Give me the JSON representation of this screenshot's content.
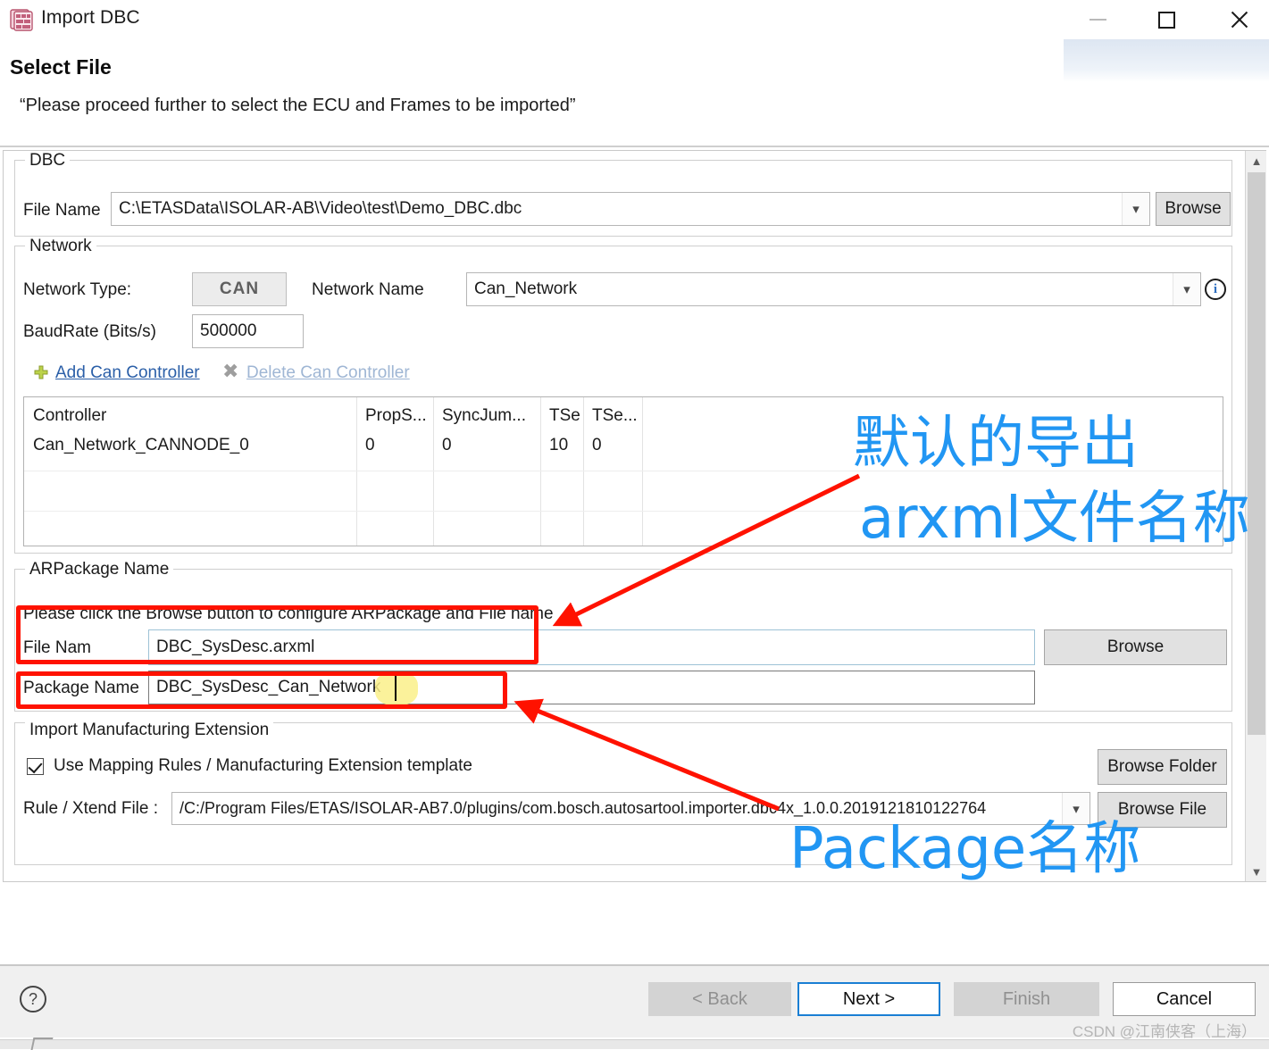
{
  "window": {
    "title": "Import DBC",
    "app_icon": "dbc-grid-icon",
    "minimize": "minimize-icon",
    "maximize": "maximize-icon",
    "close": "close-icon"
  },
  "header": {
    "title": "Select File",
    "subtitle": "“Please proceed further to select the ECU and Frames to be imported”"
  },
  "dbc_group": {
    "legend": "DBC",
    "file_name_label": "File Name",
    "file_name_value": "C:\\ETASData\\ISOLAR-AB\\Video\\test\\Demo_DBC.dbc",
    "browse_label": "Browse"
  },
  "network_group": {
    "legend": "Network",
    "network_type_label": "Network Type:",
    "network_type_value": "CAN",
    "network_name_label": "Network Name",
    "network_name_value": "Can_Network",
    "baudrate_label": "BaudRate (Bits/s)",
    "baudrate_value": "500000",
    "info_icon": "info-icon",
    "add_controller_label": "Add Can Controller",
    "delete_controller_label": "Delete Can Controller",
    "table": {
      "columns": [
        "Controller",
        "PropS...",
        "SyncJum...",
        "TSe...",
        "TSe...",
        ""
      ],
      "rows": [
        [
          "Can_Network_CANNODE_0",
          "0",
          "0",
          "10",
          "0",
          ""
        ]
      ]
    }
  },
  "arpackage_group": {
    "legend": "ARPackage Name",
    "hint": "Please click the Browse button to configure ARPackage and File name",
    "file_name_label": "File Nam",
    "file_name_value": "DBC_SysDesc.arxml",
    "package_name_label": "Package Name",
    "package_name_value": "DBC_SysDesc_Can_Network",
    "browse_label": "Browse"
  },
  "manufacturing_group": {
    "legend": "Import Manufacturing Extension",
    "checkbox_label": "Use Mapping Rules / Manufacturing Extension template",
    "checkbox_checked": true,
    "rule_file_label": "Rule / Xtend File :",
    "rule_file_value": "/C:/Program Files/ETAS/ISOLAR-AB7.0/plugins/com.bosch.autosartool.importer.dbc4x_1.0.0.2019121810122764",
    "browse_folder_label": "Browse Folder",
    "browse_file_label": "Browse File"
  },
  "footer": {
    "help_icon": "help-icon",
    "back_label": "< Back",
    "next_label": "Next >",
    "finish_label": "Finish",
    "cancel_label": "Cancel",
    "watermark": "CSDN @江南侠客（上海）"
  },
  "annotations": {
    "accent_blue": "#2196f3",
    "accent_red": "#ff1200",
    "note1_line1": "默认的导出",
    "note1_line2": "arxml文件名称",
    "note2": "Package名称"
  }
}
